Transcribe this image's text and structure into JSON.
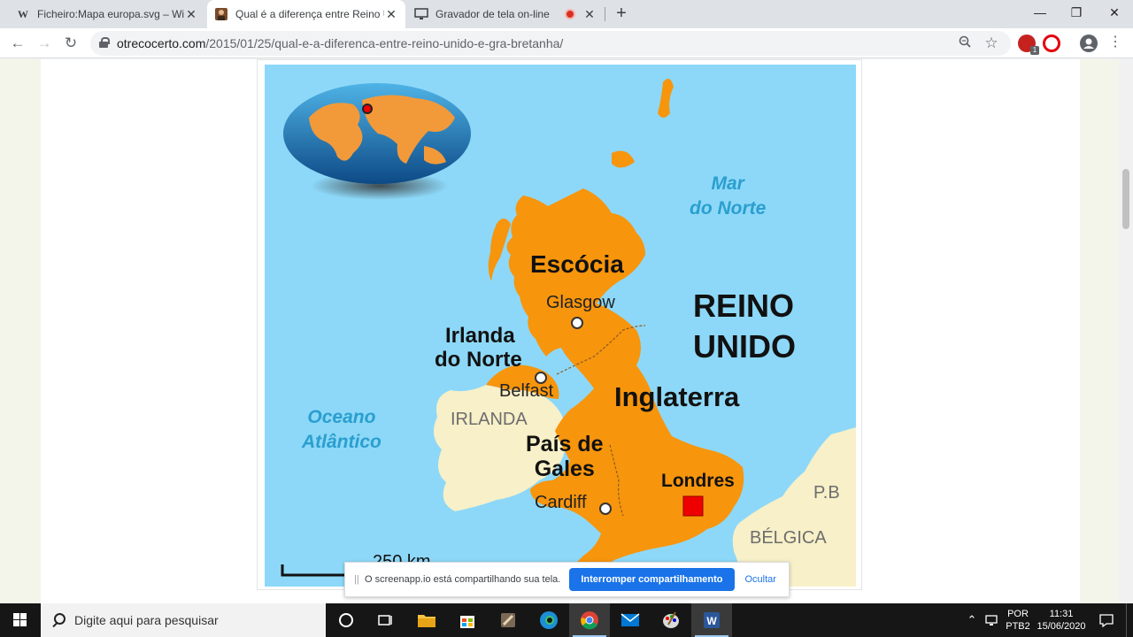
{
  "tabs": [
    {
      "favicon": "W",
      "title": "Ficheiro:Mapa europa.svg – Wikip",
      "close": "✕"
    },
    {
      "favicon": "",
      "title": "Qual é a diferença entre Reino U",
      "close": "✕"
    },
    {
      "favicon": "",
      "title": "Gravador de tela on-line",
      "close": "✕"
    }
  ],
  "new_tab": "+",
  "window_controls": {
    "minimize": "—",
    "maximize": "❐",
    "close": "✕"
  },
  "nav": {
    "back": "←",
    "forward": "→",
    "reload": "↻"
  },
  "address": {
    "host": "otrecocerto.com",
    "path": "/2015/01/25/qual-e-a-diferenca-entre-reino-unido-e-gra-bretanha/"
  },
  "omnibox_icons": {
    "zoom": "zoom-icon",
    "star": "☆"
  },
  "extensions": {
    "adblock_badge": "1"
  },
  "map": {
    "sea_north": [
      "Mar",
      "do Norte"
    ],
    "ocean": [
      "Oceano",
      "Atlântico"
    ],
    "scotland": "Escócia",
    "glasgow": "Glasgow",
    "uk": [
      "REINO",
      "UNIDO"
    ],
    "northern_ireland": [
      "Irlanda",
      "do Norte"
    ],
    "belfast": "Belfast",
    "england": "Inglaterra",
    "ireland": "IRLANDA",
    "wales": [
      "País de",
      "Gales"
    ],
    "london": "Londres",
    "cardiff": "Cardiff",
    "netherlands": "P.B",
    "belgium": "BÉLGICA",
    "scale": "250 km"
  },
  "sharebar": {
    "grip": "||",
    "message": "O screenapp.io está compartilhando sua tela.",
    "stop": "Interromper compartilhamento",
    "hide": "Ocultar"
  },
  "taskbar": {
    "search_placeholder": "Digite aqui para pesquisar",
    "lang": "POR",
    "layout": "PTB2",
    "time": "11:31",
    "date": "15/06/2020"
  }
}
